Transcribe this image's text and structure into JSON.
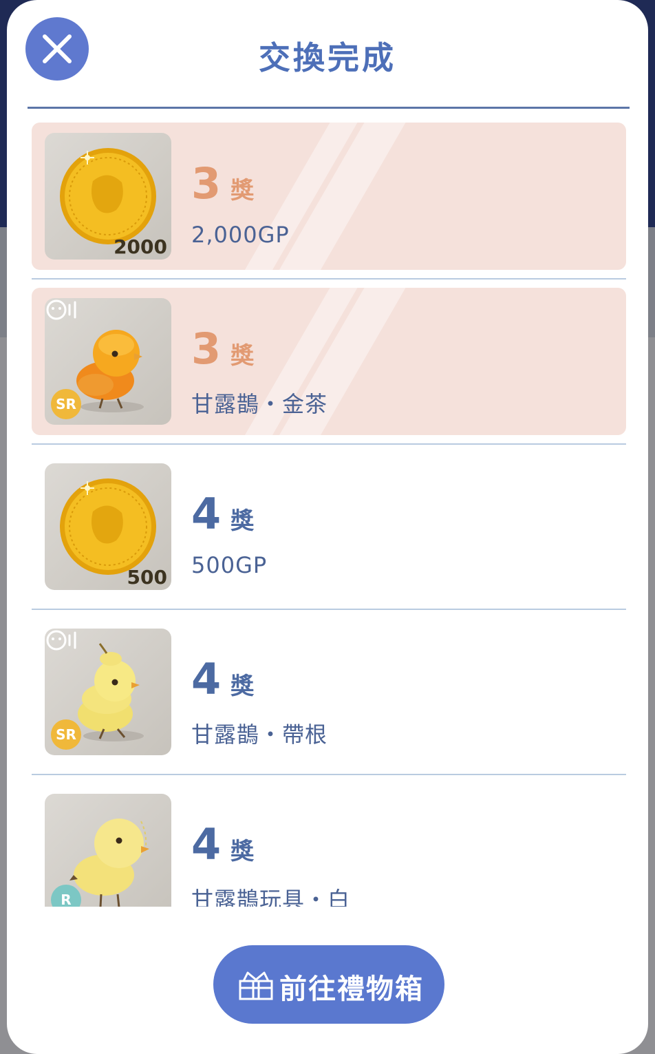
{
  "dialog": {
    "title": "交換完成",
    "close_icon": "close-icon",
    "button_label": "前往禮物箱",
    "button_icon": "gift-box-icon"
  },
  "colors": {
    "accent": "#5a78cf",
    "title": "#4d6fb8",
    "highlight_bg": "#f5e1db",
    "rank_orange": "#e29a72",
    "rank_blue": "#4c6aa2"
  },
  "prizes": [
    {
      "rank": "3",
      "rank_label": "獎",
      "name": "2,000GP",
      "quantity": "2000",
      "icon": "gold-coin-icon",
      "highlighted": true
    },
    {
      "rank": "3",
      "rank_label": "獎",
      "name": "甘露鵲・金茶",
      "rarity": "SR",
      "icon": "orange-bird-icon",
      "highlighted": true
    },
    {
      "rank": "4",
      "rank_label": "獎",
      "name": "500GP",
      "quantity": "500",
      "icon": "gold-coin-icon",
      "highlighted": false
    },
    {
      "rank": "4",
      "rank_label": "獎",
      "name": "甘露鵲・帶根",
      "rarity": "SR",
      "icon": "yellow-bird-icon",
      "highlighted": false
    },
    {
      "rank": "4",
      "rank_label": "獎",
      "name": "甘露鵲玩具・白",
      "rarity": "R",
      "icon": "toy-bird-icon",
      "highlighted": false
    }
  ]
}
